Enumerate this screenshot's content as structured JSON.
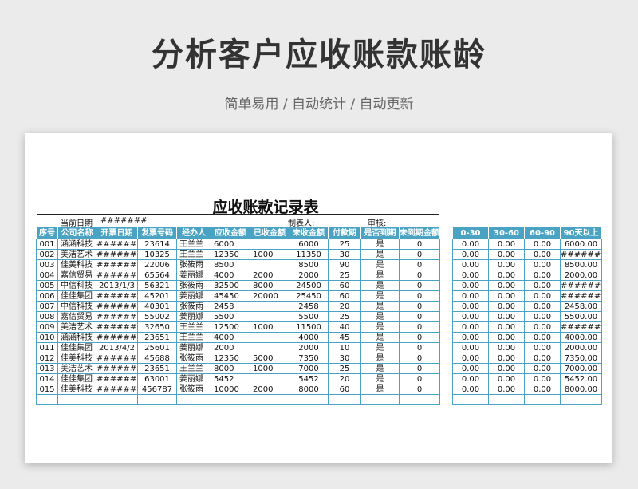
{
  "page": {
    "title": "分析客户应收账款账龄",
    "subtitle": "简单易用 / 自动统计 / 自动更新"
  },
  "sheet": {
    "title": "应收账款记录表",
    "current_date_label": "当前日期",
    "current_date_value": "#######",
    "maker_label": "制表人:",
    "reviewer_label": "审核:"
  },
  "left_headers": [
    "序号",
    "公司名称",
    "开票日期",
    "发票号码",
    "经办人",
    "应收金额",
    "已收金额",
    "未收金额",
    "付款期",
    "是否到期",
    "未到期金额"
  ],
  "right_headers": [
    "0-30",
    "30-60",
    "60-90",
    "90天以上"
  ],
  "rows": [
    [
      "001",
      "涵涵科技",
      "#######",
      "23614",
      "王兰兰",
      "6000",
      "",
      "6000",
      "25",
      "是",
      "0"
    ],
    [
      "002",
      "美洁艺术",
      "#######",
      "10325",
      "王兰兰",
      "12350",
      "1000",
      "11350",
      "30",
      "是",
      "0"
    ],
    [
      "003",
      "佳美科技",
      "#######",
      "22006",
      "张筱雨",
      "8500",
      "",
      "8500",
      "90",
      "是",
      "0"
    ],
    [
      "004",
      "嘉信贸易",
      "#######",
      "65564",
      "姜丽娜",
      "4000",
      "2000",
      "2000",
      "25",
      "是",
      "0"
    ],
    [
      "005",
      "中信科技",
      "2013/1/3",
      "56321",
      "张筱雨",
      "32500",
      "8000",
      "24500",
      "60",
      "是",
      "0"
    ],
    [
      "006",
      "佳佳集团",
      "#######",
      "45201",
      "姜丽娜",
      "45450",
      "20000",
      "25450",
      "60",
      "是",
      "0"
    ],
    [
      "007",
      "中信科技",
      "#######",
      "40301",
      "张筱雨",
      "2458",
      "",
      "2458",
      "20",
      "是",
      "0"
    ],
    [
      "008",
      "嘉信贸易",
      "#######",
      "55002",
      "姜丽娜",
      "5500",
      "",
      "5500",
      "25",
      "是",
      "0"
    ],
    [
      "009",
      "美洁艺术",
      "#######",
      "32650",
      "王兰兰",
      "12500",
      "1000",
      "11500",
      "40",
      "是",
      "0"
    ],
    [
      "010",
      "涵涵科技",
      "#######",
      "23651",
      "王兰兰",
      "4000",
      "",
      "4000",
      "45",
      "是",
      "0"
    ],
    [
      "011",
      "佳佳集团",
      "2013/4/2",
      "25601",
      "姜丽娜",
      "2000",
      "",
      "2000",
      "10",
      "是",
      "0"
    ],
    [
      "012",
      "佳美科技",
      "#######",
      "45688",
      "张筱雨",
      "12350",
      "5000",
      "7350",
      "30",
      "是",
      "0"
    ],
    [
      "013",
      "美洁艺术",
      "#######",
      "23651",
      "王兰兰",
      "8000",
      "1000",
      "7000",
      "25",
      "是",
      "0"
    ],
    [
      "014",
      "佳佳集团",
      "#######",
      "63001",
      "姜丽娜",
      "5452",
      "",
      "5452",
      "20",
      "是",
      "0"
    ],
    [
      "015",
      "佳美科技",
      "#######",
      "456787",
      "张筱雨",
      "10000",
      "2000",
      "8000",
      "60",
      "是",
      "0"
    ]
  ],
  "aging_rows": [
    [
      "0.00",
      "0.00",
      "0.00",
      "6000.00"
    ],
    [
      "0.00",
      "0.00",
      "0.00",
      "#######"
    ],
    [
      "0.00",
      "0.00",
      "0.00",
      "8500.00"
    ],
    [
      "0.00",
      "0.00",
      "0.00",
      "2000.00"
    ],
    [
      "0.00",
      "0.00",
      "0.00",
      "#######"
    ],
    [
      "0.00",
      "0.00",
      "0.00",
      "#######"
    ],
    [
      "0.00",
      "0.00",
      "0.00",
      "2458.00"
    ],
    [
      "0.00",
      "0.00",
      "0.00",
      "5500.00"
    ],
    [
      "0.00",
      "0.00",
      "0.00",
      "#######"
    ],
    [
      "0.00",
      "0.00",
      "0.00",
      "4000.00"
    ],
    [
      "0.00",
      "0.00",
      "0.00",
      "2000.00"
    ],
    [
      "0.00",
      "0.00",
      "0.00",
      "7350.00"
    ],
    [
      "0.00",
      "0.00",
      "0.00",
      "7000.00"
    ],
    [
      "0.00",
      "0.00",
      "0.00",
      "5452.00"
    ],
    [
      "0.00",
      "0.00",
      "0.00",
      "8000.00"
    ]
  ],
  "colors": {
    "header_bg": "#4aa3c2",
    "grid": "#4aa3c2"
  }
}
